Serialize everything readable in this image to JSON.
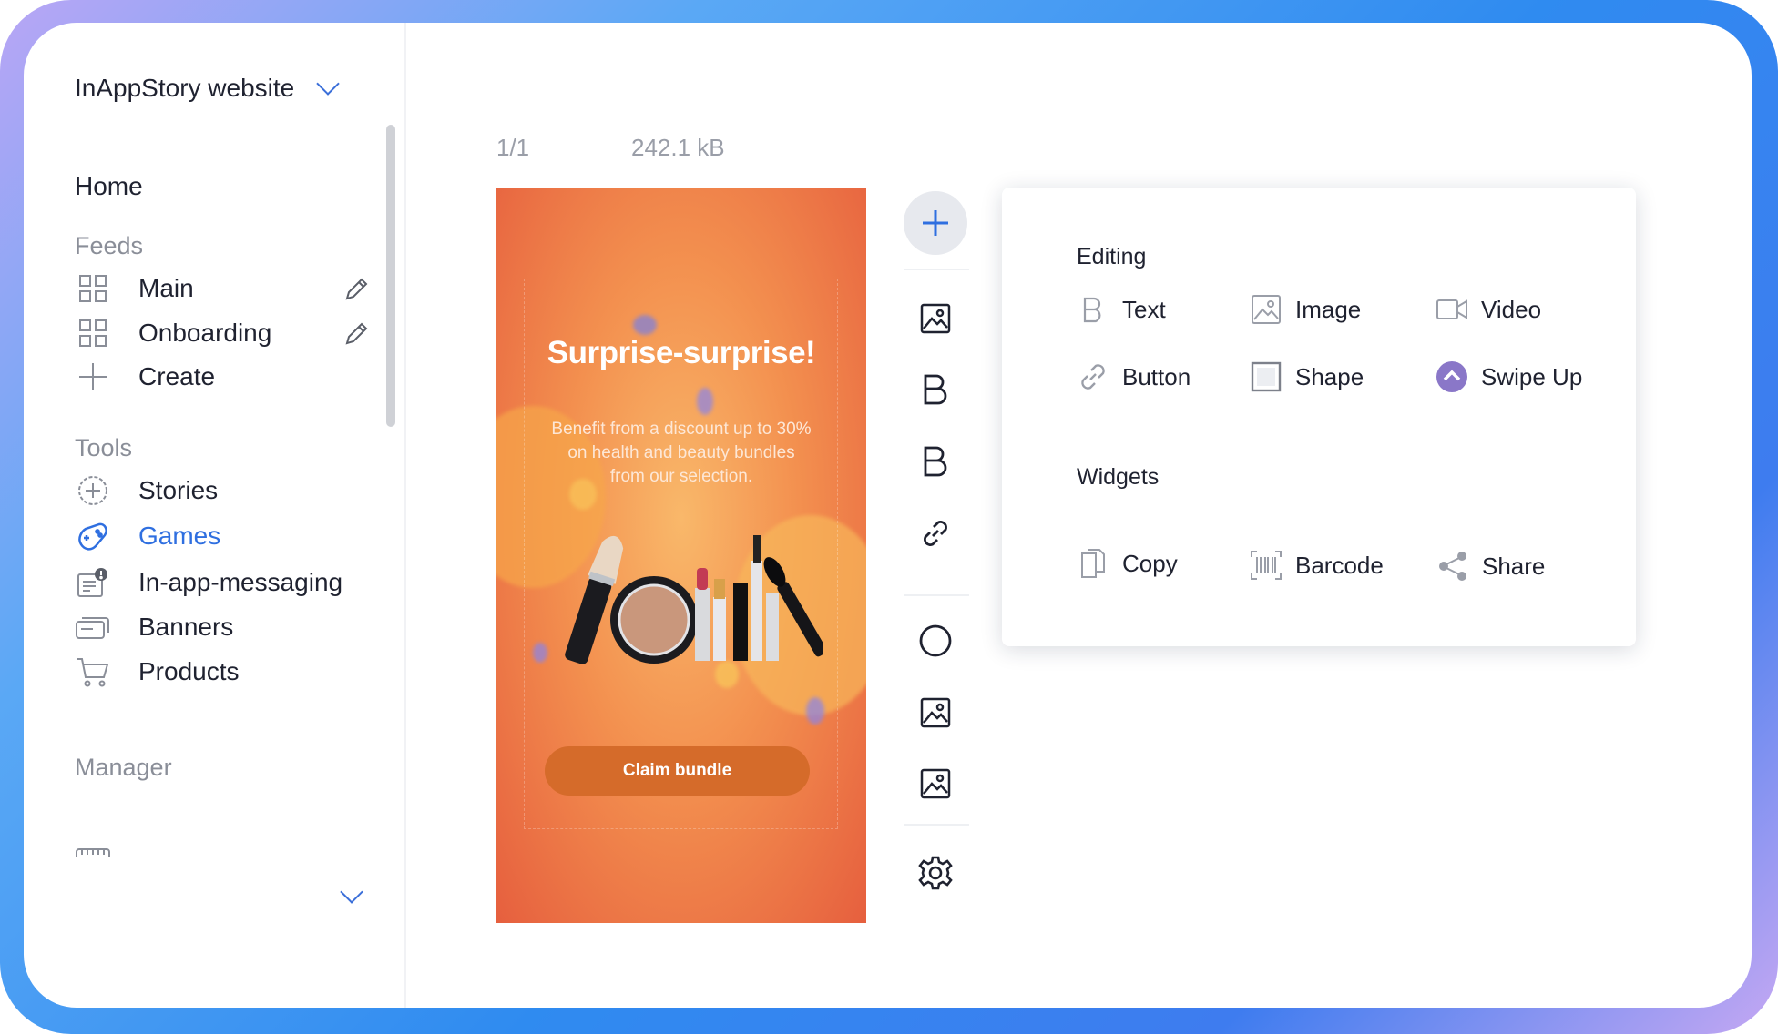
{
  "sidebar": {
    "workspace": "InAppStory website",
    "home": "Home",
    "feeds_title": "Feeds",
    "feeds": [
      {
        "label": "Main"
      },
      {
        "label": "Onboarding"
      },
      {
        "label": "Create"
      }
    ],
    "tools_title": "Tools",
    "tools": [
      {
        "label": "Stories"
      },
      {
        "label": "Games"
      },
      {
        "label": "In-app-messaging"
      },
      {
        "label": "Banners"
      },
      {
        "label": "Products"
      }
    ],
    "manager_title": "Manager"
  },
  "editor": {
    "page_counter": "1/1",
    "size": "242.1 kB"
  },
  "story": {
    "title": "Surprise-surprise!",
    "body": "Benefit from a discount up to 30% on health and beauty bundles from our selection.",
    "cta": "Claim bundle"
  },
  "toolbar": {
    "items": [
      "plus-icon",
      "image-icon",
      "bold-icon",
      "bold-icon",
      "link-icon",
      "circle-icon",
      "image-icon",
      "image-icon",
      "gear-icon"
    ]
  },
  "panel": {
    "editing_title": "Editing",
    "editing": [
      {
        "label": "Text",
        "icon": "text-icon"
      },
      {
        "label": "Image",
        "icon": "image-icon"
      },
      {
        "label": "Video",
        "icon": "video-icon"
      },
      {
        "label": "Button",
        "icon": "link-icon"
      },
      {
        "label": "Shape",
        "icon": "square-icon"
      },
      {
        "label": "Swipe Up",
        "icon": "chevron-up-icon"
      }
    ],
    "widgets_title": "Widgets",
    "widgets": [
      {
        "label": "Copy",
        "icon": "copy-icon"
      },
      {
        "label": "Barcode",
        "icon": "barcode-icon"
      },
      {
        "label": "Share",
        "icon": "share-icon"
      }
    ]
  },
  "colors": {
    "accent": "#2f6fe0",
    "story_bg": "#e65f3e",
    "cta_bg": "#d56b2a"
  }
}
